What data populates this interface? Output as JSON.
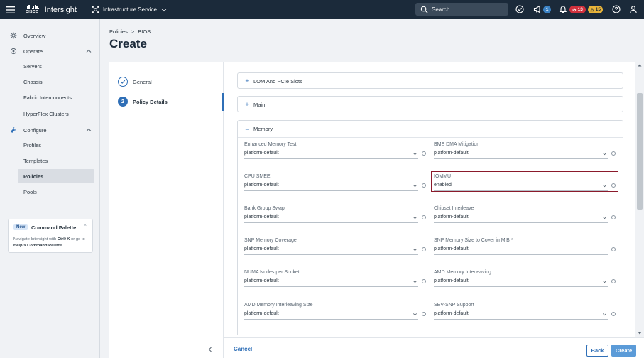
{
  "topbar": {
    "menu_icon": "hamburger-icon",
    "logo_text": "CISCO",
    "brand": "Intersight",
    "service": "Infrastructure Service",
    "search_placeholder": "Search",
    "announce_count": "1",
    "alarm_critical_count": "13",
    "alarm_warning_count": "15"
  },
  "sidebar": {
    "items": [
      {
        "label": "Overview",
        "icon": "overview-icon"
      },
      {
        "label": "Operate",
        "icon": "operate-icon"
      },
      {
        "label": "Servers"
      },
      {
        "label": "Chassis"
      },
      {
        "label": "Fabric Interconnects"
      },
      {
        "label": "HyperFlex Clusters"
      },
      {
        "label": "Configure",
        "icon": "wrench-icon"
      },
      {
        "label": "Profiles"
      },
      {
        "label": "Templates"
      },
      {
        "label": "Policies"
      },
      {
        "label": "Pools"
      }
    ],
    "command_palette": {
      "badge": "New",
      "title": "Command Palette",
      "close": "×",
      "desc_1": "Navigate Intersight with ",
      "desc_keys": "Ctrl+K",
      "desc_2": " or go to ",
      "desc_path": "Help > Command Palette"
    }
  },
  "header": {
    "breadcrumb_1": "Policies",
    "breadcrumb_sep": ">",
    "breadcrumb_2": "BIOS",
    "title": "Create"
  },
  "wizard": {
    "steps": [
      {
        "label": "General",
        "status": "done"
      },
      {
        "number": "2",
        "label": "Policy Details",
        "status": "current"
      }
    ]
  },
  "sections": {
    "lom": {
      "sign": "+",
      "label": "LOM And PCIe Slots"
    },
    "main": {
      "sign": "+",
      "label": "Main"
    },
    "memory": {
      "sign": "−",
      "label": "Memory"
    }
  },
  "fields": [
    {
      "label": "Enhanced Memory Test",
      "value": "platform-default"
    },
    {
      "label": "BME DMA Mitigation",
      "value": "platform-default"
    },
    {
      "label": "CPU SMEE",
      "value": "platform-default"
    },
    {
      "label": "IOMMU",
      "value": "enabled"
    },
    {
      "label": "Bank Group Swap",
      "value": "platform-default"
    },
    {
      "label": "Chipset Interleave",
      "value": "platform-default"
    },
    {
      "label": "SNP Memory Coverage",
      "value": "platform-default"
    },
    {
      "label": "SNP Memory Size to Cover in MiB *",
      "value": "platform-default"
    },
    {
      "label": "NUMA Nodes per Socket",
      "value": "platform-default"
    },
    {
      "label": "AMD Memory Interleaving",
      "value": "platform-default"
    },
    {
      "label": "AMD Memory Interleaving Size",
      "value": "platform-default"
    },
    {
      "label": "SEV-SNP Support",
      "value": "platform-default"
    }
  ],
  "footer": {
    "cancel": "Cancel",
    "back": "Back",
    "create": "Create"
  },
  "colors": {
    "topbar": "#1b2a3a",
    "accent": "#2f6fb7",
    "highlight": "#8b1a2b",
    "critical": "#d0303c",
    "warning": "#e8b43a"
  }
}
